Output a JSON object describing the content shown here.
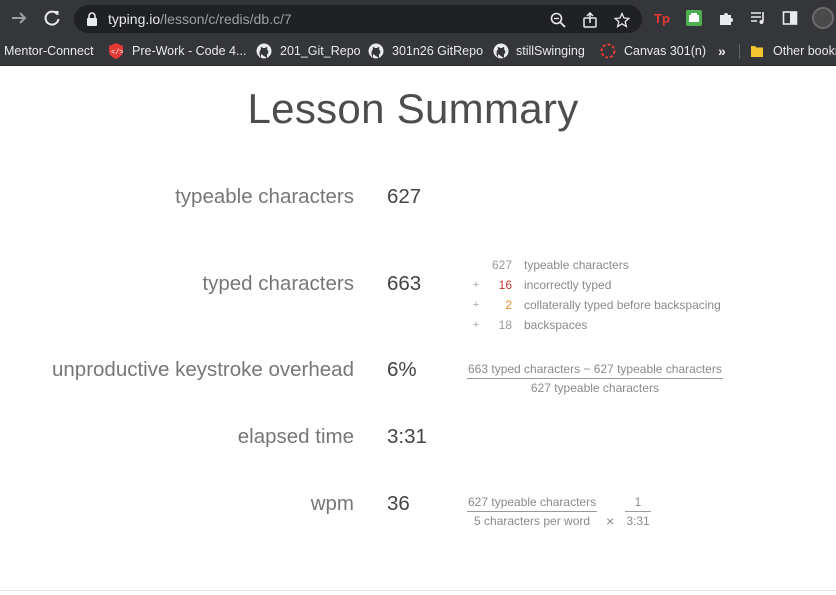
{
  "browser": {
    "url_host": "typing.io",
    "url_path": "/lesson/c/redis/db.c/7",
    "bookmarks": [
      {
        "label": "Mentor-Connect",
        "icon": "none"
      },
      {
        "label": "Pre-Work - Code 4...",
        "icon": "code-fellows-icon"
      },
      {
        "label": "201_Git_Repo",
        "icon": "github-icon"
      },
      {
        "label": "301n26 GitRepo",
        "icon": "github-icon"
      },
      {
        "label": "stillSwinging",
        "icon": "github-icon"
      },
      {
        "label": "Canvas 301(n)",
        "icon": "canvas-icon"
      }
    ],
    "overflow": "»",
    "other_bookmarks": "Other bookmarks"
  },
  "summary": {
    "title": "Lesson Summary",
    "typeable": {
      "label": "typeable characters",
      "value": "627"
    },
    "typed": {
      "label": "typed characters",
      "value": "663"
    },
    "overhead": {
      "label": "unproductive keystroke overhead",
      "value": "6%"
    },
    "elapsed": {
      "label": "elapsed time",
      "value": "3:31"
    },
    "wpm": {
      "label": "wpm",
      "value": "36"
    }
  },
  "breakdown": [
    {
      "op": "",
      "num": "627",
      "text": "typeable characters",
      "color": "#999999"
    },
    {
      "op": "+",
      "num": "16",
      "text": "incorrectly typed",
      "color": "#c0392b"
    },
    {
      "op": "+",
      "num": "2",
      "text": "collaterally typed before backspacing",
      "color": "#e08a1e"
    },
    {
      "op": "+",
      "num": "18",
      "text": "backspaces",
      "color": "#999999"
    }
  ],
  "overhead_formula": {
    "numerator": "663 typed characters − 627 typeable characters",
    "denominator": "627 typeable characters"
  },
  "wpm_formula": {
    "numerator": "627 typeable characters",
    "denominator": "5 characters per word",
    "times": "×",
    "numerator2": "1",
    "denominator2": "3:31"
  }
}
